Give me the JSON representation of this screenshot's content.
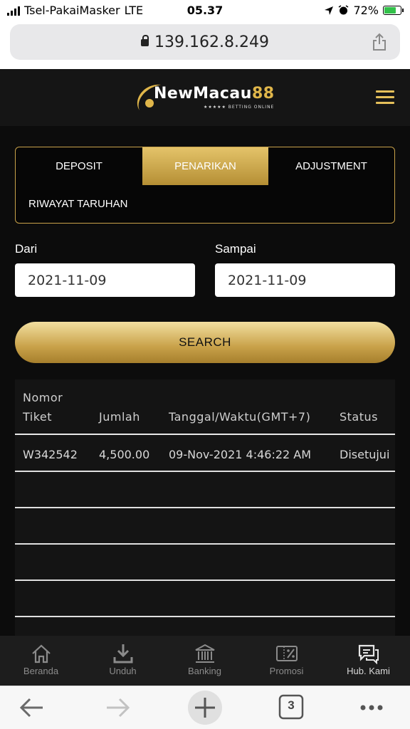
{
  "status_bar": {
    "carrier": "Tsel-PakaiMasker",
    "network": "LTE",
    "time": "05.37",
    "battery": "72%",
    "battery_level_percent": 72
  },
  "browser": {
    "url": "139.162.8.249",
    "tabs_count": "3"
  },
  "header": {
    "logo_main": "NewMacau",
    "logo_accent": "88",
    "logo_sub": "★★★★★ BETTING ONLINE"
  },
  "tabs": [
    {
      "label": "DEPOSIT"
    },
    {
      "label": "PENARIKAN"
    },
    {
      "label": "ADJUSTMENT"
    },
    {
      "label": "RIWAYAT TARUHAN"
    }
  ],
  "filter": {
    "from_label": "Dari",
    "from_value": "2021-11-09",
    "to_label": "Sampai",
    "to_value": "2021-11-09",
    "search_label": "SEARCH"
  },
  "table": {
    "headers": {
      "ticket_line1": "Nomor",
      "ticket_line2": "Tiket",
      "amount": "Jumlah",
      "datetime": "Tanggal/Waktu(GMT+7)",
      "status": "Status"
    },
    "rows": [
      {
        "ticket": "W342542",
        "amount": "4,500.00",
        "datetime": "09-Nov-2021 4:46:22 AM",
        "status": "Disetujui"
      }
    ]
  },
  "bottom_nav": [
    {
      "label": "Beranda",
      "icon": "home-icon"
    },
    {
      "label": "Unduh",
      "icon": "download-icon"
    },
    {
      "label": "Banking",
      "icon": "bank-icon"
    },
    {
      "label": "Promosi",
      "icon": "promo-icon"
    },
    {
      "label": "Hub. Kami",
      "icon": "chat-icon"
    }
  ],
  "colors": {
    "gold": "#c9a24a",
    "background": "#0c0c0c"
  }
}
